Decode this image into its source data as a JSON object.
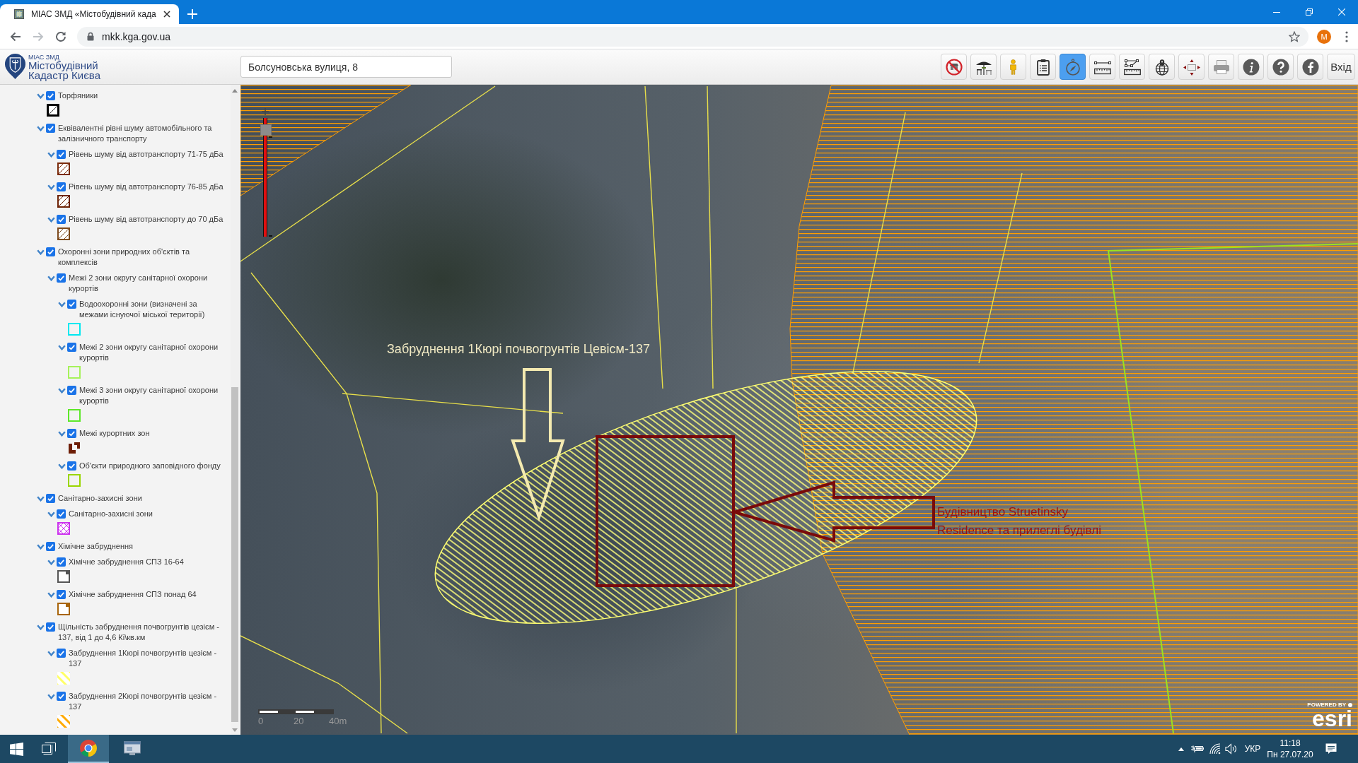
{
  "browser": {
    "tab": {
      "title": "МІАС ЗМД «Містобудівний када"
    },
    "address": "mkk.kga.gov.ua",
    "profile": "M"
  },
  "header": {
    "logo": {
      "small": "МІАС ЗМД",
      "line1": "Містобудівний",
      "line2": "Кадастр Києва"
    },
    "search": {
      "value": "Болсуновська вулиця, 8"
    },
    "tools": [
      {
        "kind": "no-store",
        "selected": false
      },
      {
        "kind": "cafe",
        "selected": false
      },
      {
        "kind": "person",
        "selected": false
      },
      {
        "kind": "clipboard",
        "selected": false
      },
      {
        "kind": "compass",
        "selected": true
      },
      {
        "kind": "distance",
        "selected": false
      },
      {
        "kind": "area",
        "selected": false
      },
      {
        "kind": "globe-pin",
        "selected": false
      },
      {
        "kind": "extent",
        "selected": false
      },
      {
        "kind": "printer",
        "selected": false
      },
      {
        "kind": "info",
        "selected": false
      },
      {
        "kind": "help",
        "selected": false
      },
      {
        "kind": "social",
        "selected": false
      },
      {
        "kind": "login",
        "label": "Вхід",
        "selected": false
      }
    ]
  },
  "layers": [
    {
      "label": "Торфяники",
      "expanded": true,
      "checked": true,
      "legend": {
        "kind": "framed",
        "color": "#000000"
      }
    },
    {
      "label": "Еквівалентні рівні шуму автомобільного та залізничного транспорту",
      "expanded": true,
      "checked": true,
      "children": [
        {
          "label": "Рівень шуму від автотранспорту 71-75 дБа",
          "expanded": true,
          "checked": true,
          "legend": {
            "kind": "hatch",
            "color": "#7b2c0c"
          }
        },
        {
          "label": "Рівень шуму від автотранспорту 76-85 дБа",
          "expanded": true,
          "checked": true,
          "legend": {
            "kind": "hatch",
            "color": "#6e2406"
          }
        },
        {
          "label": "Рівень шуму від автотранспорту до 70 дБа",
          "expanded": true,
          "checked": true,
          "legend": {
            "kind": "hatch",
            "color": "#7d4a1c"
          }
        }
      ]
    },
    {
      "label": "Охоронні зони природних об'єктів та комплексів",
      "expanded": true,
      "checked": true,
      "children": [
        {
          "label": "Межі 2 зони округу санітарної охорони курортів",
          "expanded": true,
          "checked": true,
          "children": [
            {
              "label": "Водоохоронні зони (визначені за межами існуючої міської території)",
              "expanded": true,
              "checked": true,
              "legend": {
                "kind": "outline",
                "color": "#00e8f0"
              }
            },
            {
              "label": "Межі 2 зони округу санітарної охорони курортів",
              "expanded": true,
              "checked": true,
              "legend": {
                "kind": "outline",
                "color": "#a6f25a"
              }
            },
            {
              "label": "Межі 3 зони округу санітарної охорони курортів",
              "expanded": true,
              "checked": true,
              "legend": {
                "kind": "outline",
                "color": "#5ee82a"
              }
            },
            {
              "label": "Межі курортних зон",
              "expanded": true,
              "checked": true,
              "legend": {
                "kind": "bracket",
                "color": "#6e1e06"
              }
            },
            {
              "label": "Об'єкти природного заповідного фонду",
              "expanded": true,
              "checked": true,
              "legend": {
                "kind": "outline",
                "color": "#9ad600"
              }
            }
          ]
        }
      ]
    },
    {
      "label": "Санітарно-захисні зони",
      "expanded": true,
      "checked": true,
      "children": [
        {
          "label": "Санітарно-захисні зони",
          "expanded": true,
          "checked": true,
          "legend": {
            "kind": "cross",
            "color": "#cc33ee"
          }
        }
      ]
    },
    {
      "label": "Хімічне забруднення",
      "expanded": true,
      "checked": true,
      "children": [
        {
          "label": "Хімічне забруднення СПЗ 16-64",
          "expanded": true,
          "checked": true,
          "legend": {
            "kind": "corner",
            "color": "#555555"
          }
        },
        {
          "label": "Хімічне забруднення СПЗ понад 64",
          "expanded": true,
          "checked": true,
          "legend": {
            "kind": "corner",
            "color": "#a8650a"
          }
        }
      ]
    },
    {
      "label": "Щільність забруднення почвогрунтів цезієм - 137, від 1 до 4,6 Кі\\кв.км",
      "expanded": true,
      "checked": true,
      "children": [
        {
          "label": "Забруднення 1Кюрі почвогрунтів цезієм - 137",
          "expanded": true,
          "checked": true,
          "legend": {
            "kind": "stripes",
            "color": "#ffff66"
          }
        },
        {
          "label": "Забруднення 2Кюрі почвогрунтів цезієм - 137",
          "expanded": true,
          "checked": true,
          "legend": {
            "kind": "stripes",
            "color": "#ffaa00"
          }
        }
      ]
    }
  ],
  "map": {
    "zoom_slider": {
      "level": 0.94
    },
    "scale": {
      "labels": [
        "0",
        "20",
        "40m"
      ]
    },
    "annotations": [
      {
        "kind": "caption",
        "text": "Забруднення 1Кюрі почвогрунтів Цевісм-137"
      },
      {
        "kind": "callout",
        "text": "Будівництво Struetinsky Residence та прилеглі будівлі"
      }
    ],
    "attribution": {
      "powered_by": "POWERED BY",
      "logo": "esri"
    }
  },
  "taskbar": {
    "apps": [
      {
        "kind": "browser",
        "selected": true
      },
      {
        "kind": "window",
        "selected": false
      }
    ],
    "language": "УКР",
    "time": "11:18",
    "date": "Пн 27.07.20"
  }
}
